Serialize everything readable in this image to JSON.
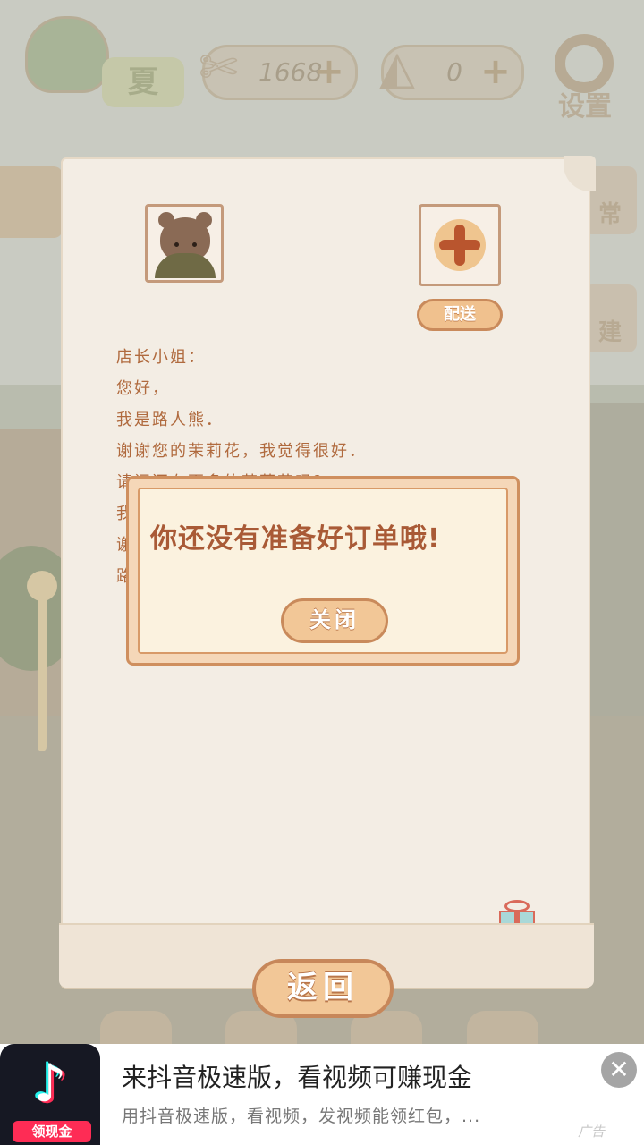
{
  "hud": {
    "season_label": "夏",
    "fish": {
      "icon": "fishbone-icon",
      "value": "1668"
    },
    "cheese": {
      "icon": "cheese-icon",
      "value": "0"
    },
    "add_symbol": "+",
    "settings_label": "设置"
  },
  "side_tags": [
    "常",
    "建"
  ],
  "letter": {
    "deliver_label": "配送",
    "lines": [
      "店长小姐：",
      "您好，",
      "我是路人熊．",
      "谢谢您的茉莉花，我觉得很好．",
      "请问还有更多的茉莉花吗？",
      "我",
      "谢",
      "路"
    ]
  },
  "modal": {
    "message": "你还没有准备好订单哦!",
    "close_label": "关闭"
  },
  "back_label": "返回",
  "ad": {
    "cash_label": "领现金",
    "title": "来抖音极速版，看视频可赚现金",
    "description": "用抖音极速版，看视频，发视频能领红包，...",
    "label": "广告",
    "close_symbol": "✕"
  },
  "colors": {
    "accent_orange": "#f2c797",
    "text_brown": "#a95a36",
    "paper": "#f3ede4"
  }
}
